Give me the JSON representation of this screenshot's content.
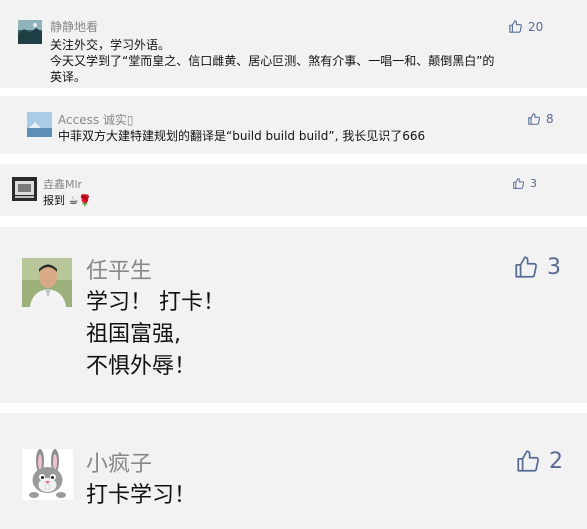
{
  "colors": {
    "card_bg": "#f2f2f2",
    "name": "#888888",
    "like": "#576b95",
    "text": "#111111"
  },
  "comments": [
    {
      "avatar_icon": "landscape-photo-avatar",
      "name": "静静地看",
      "content": "关注外交，学习外语。\n今天又学到了“堂而皇之、信口雌黄、居心叵测、煞有介事、一唱一和、颠倒黑白”的\n英译。",
      "likes": "20"
    },
    {
      "avatar_icon": "sky-photo-avatar",
      "name": "Access 诚实▯",
      "content": "中菲双方大建特建规划的翻译是“build build build”, 我长见识了666",
      "likes": "8"
    },
    {
      "avatar_icon": "dark-photo-avatar",
      "name": "垚鑫Mlr",
      "content": "报到 ☕🌹",
      "likes": "3"
    },
    {
      "avatar_icon": "man-portrait-avatar",
      "name": "任平生",
      "content": "学习！ 打卡！\n祖国富强,\n不惧外辱！",
      "likes": "3"
    },
    {
      "avatar_icon": "cartoon-rabbit-avatar",
      "name": "小疯子",
      "content": "打卡学习！",
      "likes": "2"
    }
  ]
}
